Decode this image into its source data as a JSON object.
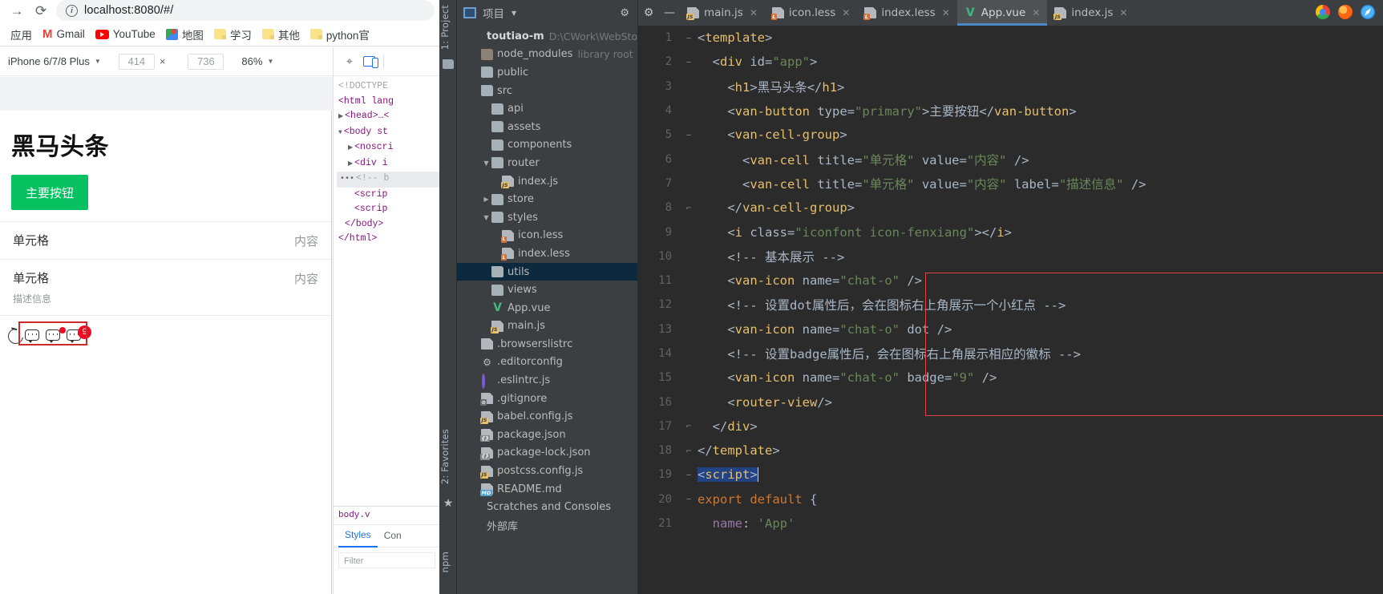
{
  "browser": {
    "url_main": "localhost",
    "url_full": "localhost:8080/#/",
    "back_icon": "forward-arrow-icon",
    "reload_icon": "reload-icon",
    "info_icon": "info-icon",
    "bookmarks": [
      {
        "label": "应用",
        "icon": "apps-icon"
      },
      {
        "label": "Gmail",
        "icon": "gmail-icon"
      },
      {
        "label": "YouTube",
        "icon": "youtube-icon"
      },
      {
        "label": "地图",
        "icon": "maps-icon"
      },
      {
        "label": "学习",
        "icon": "folder-icon"
      },
      {
        "label": "其他",
        "icon": "folder-icon"
      },
      {
        "label": "python官",
        "icon": "folder-icon"
      }
    ]
  },
  "device_toolbar": {
    "device": "iPhone 6/7/8 Plus",
    "width": "414",
    "height": "736",
    "x_separator": "×",
    "zoom": "86%",
    "caret": "▼",
    "kebab": "⋮"
  },
  "phone": {
    "heading": "黑马头条",
    "button_label": "主要按钮",
    "cells": [
      {
        "title": "单元格",
        "value": "内容",
        "label": ""
      },
      {
        "title": "单元格",
        "value": "内容",
        "label": "描述信息"
      }
    ],
    "icons": {
      "fenxiang": "share-icon",
      "chat_plain": "chat-o-icon",
      "chat_dot": "chat-o-dot-icon",
      "chat_badge": "chat-o-badge-icon",
      "badge_value": "9"
    }
  },
  "devtools": {
    "cursor_icon": "inspect-cursor-icon",
    "device_icon": "toggle-device-toolbar-icon",
    "dom": [
      "<!DOCTYPE",
      "<html lang",
      "<head>…<",
      "<body st",
      "<noscri",
      "<div i",
      "<!-- b",
      "<scrip",
      "<scrip",
      "</body>",
      "</html>"
    ],
    "breadcrumb": "body.v",
    "tabs": [
      "Styles",
      "Con"
    ],
    "filter_placeholder": "Filter"
  },
  "ide": {
    "vertical_labels": {
      "project": "1: Project",
      "favorites": "2: Favorites",
      "npm": "npm"
    },
    "project_panel": {
      "title": "项目",
      "caret": "▼",
      "gear_icon": "gear-icon",
      "minimize_icon": "minimize-icon",
      "tree": [
        {
          "indent": 0,
          "arrow": "",
          "icon": "project-root",
          "name": "toutiao-m",
          "sub": "D:\\CWork\\WebStormP",
          "root": true
        },
        {
          "indent": 1,
          "arrow": "",
          "icon": "folder-lib",
          "name": "node_modules",
          "sub": "library root"
        },
        {
          "indent": 1,
          "arrow": "",
          "icon": "folder",
          "name": "public",
          "sub": ""
        },
        {
          "indent": 1,
          "arrow": "",
          "icon": "folder",
          "name": "src",
          "sub": ""
        },
        {
          "indent": 2,
          "arrow": "",
          "icon": "folder",
          "name": "api",
          "sub": ""
        },
        {
          "indent": 2,
          "arrow": "",
          "icon": "folder",
          "name": "assets",
          "sub": ""
        },
        {
          "indent": 2,
          "arrow": "",
          "icon": "folder",
          "name": "components",
          "sub": ""
        },
        {
          "indent": 2,
          "arrow": "▼",
          "icon": "folder",
          "name": "router",
          "sub": ""
        },
        {
          "indent": 3,
          "arrow": "",
          "icon": "js",
          "name": "index.js",
          "sub": ""
        },
        {
          "indent": 2,
          "arrow": "▶",
          "icon": "folder",
          "name": "store",
          "sub": ""
        },
        {
          "indent": 2,
          "arrow": "▼",
          "icon": "folder",
          "name": "styles",
          "sub": ""
        },
        {
          "indent": 3,
          "arrow": "",
          "icon": "less",
          "name": "icon.less",
          "sub": ""
        },
        {
          "indent": 3,
          "arrow": "",
          "icon": "less",
          "name": "index.less",
          "sub": ""
        },
        {
          "indent": 2,
          "arrow": "",
          "icon": "folder",
          "name": "utils",
          "sub": "",
          "selected": true
        },
        {
          "indent": 2,
          "arrow": "",
          "icon": "folder",
          "name": "views",
          "sub": ""
        },
        {
          "indent": 2,
          "arrow": "",
          "icon": "vue",
          "name": "App.vue",
          "sub": ""
        },
        {
          "indent": 2,
          "arrow": "",
          "icon": "js",
          "name": "main.js",
          "sub": ""
        },
        {
          "indent": 1,
          "arrow": "",
          "icon": "file",
          "name": ".browserslistrc",
          "sub": ""
        },
        {
          "indent": 1,
          "arrow": "",
          "icon": "gear",
          "name": ".editorconfig",
          "sub": ""
        },
        {
          "indent": 1,
          "arrow": "",
          "icon": "eslint",
          "name": ".eslintrc.js",
          "sub": ""
        },
        {
          "indent": 1,
          "arrow": "",
          "icon": "git",
          "name": ".gitignore",
          "sub": ""
        },
        {
          "indent": 1,
          "arrow": "",
          "icon": "js",
          "name": "babel.config.js",
          "sub": ""
        },
        {
          "indent": 1,
          "arrow": "",
          "icon": "json",
          "name": "package.json",
          "sub": ""
        },
        {
          "indent": 1,
          "arrow": "",
          "icon": "json",
          "name": "package-lock.json",
          "sub": ""
        },
        {
          "indent": 1,
          "arrow": "",
          "icon": "js",
          "name": "postcss.config.js",
          "sub": ""
        },
        {
          "indent": 1,
          "arrow": "",
          "icon": "md",
          "name": "README.md",
          "sub": ""
        },
        {
          "indent": 0,
          "arrow": "",
          "icon": "none",
          "name": "Scratches and Consoles",
          "sub": ""
        },
        {
          "indent": 0,
          "arrow": "",
          "icon": "none",
          "name": "外部库",
          "sub": ""
        }
      ]
    },
    "tabs": [
      {
        "label": "main.js",
        "icon": "js",
        "active": false
      },
      {
        "label": "icon.less",
        "icon": "less",
        "active": false
      },
      {
        "label": "index.less",
        "icon": "less",
        "active": false
      },
      {
        "label": "App.vue",
        "icon": "vue",
        "active": true
      },
      {
        "label": "index.js",
        "icon": "js",
        "active": false
      }
    ],
    "code_lines": [
      {
        "n": "1",
        "fold": "−",
        "text": "<template>"
      },
      {
        "n": "2",
        "fold": "−",
        "text": "  <div id=\"app\">"
      },
      {
        "n": "3",
        "fold": "",
        "text": "    <h1>黑马头条</h1>"
      },
      {
        "n": "4",
        "fold": "",
        "text": "    <van-button type=\"primary\">主要按钮</van-button>"
      },
      {
        "n": "5",
        "fold": "−",
        "text": "    <van-cell-group>"
      },
      {
        "n": "6",
        "fold": "",
        "text": "      <van-cell title=\"单元格\" value=\"内容\" />"
      },
      {
        "n": "7",
        "fold": "",
        "text": "      <van-cell title=\"单元格\" value=\"内容\" label=\"描述信息\" />"
      },
      {
        "n": "8",
        "fold": "⌐",
        "text": "    </van-cell-group>"
      },
      {
        "n": "9",
        "fold": "",
        "text": "    <i class=\"iconfont icon-fenxiang\"></i>"
      },
      {
        "n": "10",
        "fold": "",
        "text": "    <!-- 基本展示 -->"
      },
      {
        "n": "11",
        "fold": "",
        "text": "    <van-icon name=\"chat-o\" />"
      },
      {
        "n": "12",
        "fold": "",
        "text": "    <!-- 设置dot属性后，会在图标右上角展示一个小红点 -->"
      },
      {
        "n": "13",
        "fold": "",
        "text": "    <van-icon name=\"chat-o\" dot />"
      },
      {
        "n": "14",
        "fold": "",
        "text": "    <!-- 设置badge属性后，会在图标右上角展示相应的徽标 -->"
      },
      {
        "n": "15",
        "fold": "",
        "text": "    <van-icon name=\"chat-o\" badge=\"9\" />"
      },
      {
        "n": "16",
        "fold": "",
        "text": "    <router-view/>"
      },
      {
        "n": "17",
        "fold": "⌐",
        "text": "  </div>"
      },
      {
        "n": "18",
        "fold": "⌐",
        "text": "</template>"
      },
      {
        "n": "19",
        "fold": "−",
        "text": "<script>"
      },
      {
        "n": "20",
        "fold": "−",
        "text": "export default {"
      },
      {
        "n": "21",
        "fold": "",
        "text": "  name: 'App'"
      }
    ],
    "window_buttons": [
      "chrome-icon",
      "firefox-icon",
      "safari-icon"
    ]
  },
  "colors": {
    "accent_green": "#07c160",
    "badge_red": "#ee0a24",
    "highlight_red": "#e04343",
    "ide_bg": "#2b2b2b",
    "panel_bg": "#3c3f41",
    "selection_blue": "#0d293e",
    "tab_active_underline": "#4a88c7"
  }
}
